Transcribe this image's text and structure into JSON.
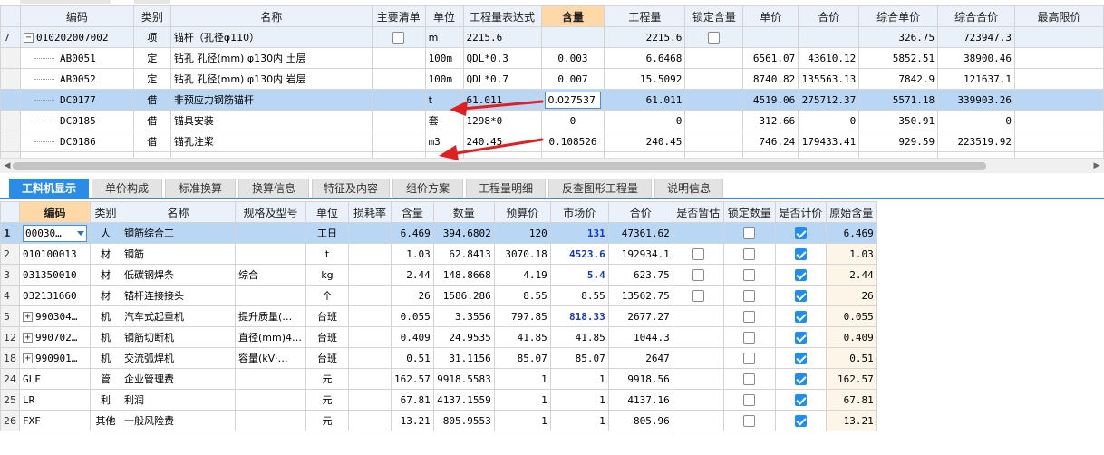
{
  "top_grid": {
    "columns": [
      "编码",
      "类别",
      "名称",
      "主要清单",
      "单位",
      "工程量表达式",
      "含量",
      "工程量",
      "锁定含量",
      "单价",
      "合价",
      "综合单价",
      "综合合价",
      "最高限价"
    ],
    "rows": [
      {
        "rn": "7",
        "code": "010202007002",
        "type": "项",
        "name": "锚杆（孔径φ110）",
        "main": "unchecked",
        "unit": "m",
        "expr": "2215.6",
        "qty_ratio": "",
        "qty": "2215.6",
        "lock": "unchecked",
        "price": "",
        "total": "",
        "comp_price": "326.75",
        "comp_total": "723947.3"
      },
      {
        "rn": "",
        "code": "AB0051",
        "type": "定",
        "name": "钻孔 孔径(mm) φ130内 土层",
        "unit": "100m",
        "expr": "QDL*0.3",
        "qty_ratio": "0.003",
        "qty": "6.6468",
        "price": "6561.07",
        "total": "43610.12",
        "comp_price": "5852.51",
        "comp_total": "38900.46"
      },
      {
        "rn": "",
        "code": "AB0052",
        "type": "定",
        "name": "钻孔 孔径(mm) φ130内 岩层",
        "unit": "100m",
        "expr": "QDL*0.7",
        "qty_ratio": "0.007",
        "qty": "15.5092",
        "price": "8740.82",
        "total": "135563.13",
        "comp_price": "7842.9",
        "comp_total": "121637.1"
      },
      {
        "rn": "",
        "code": "DC0177",
        "type": "借",
        "name": "非预应力钢筋锚杆",
        "unit": "t",
        "expr": "61.011",
        "qty_ratio": "0.027537",
        "qty": "61.011",
        "price": "4519.06",
        "total": "275712.37",
        "comp_price": "5571.18",
        "comp_total": "339903.26"
      },
      {
        "rn": "",
        "code": "DC0185",
        "type": "借",
        "name": "锚具安装",
        "unit": "套",
        "expr": "1298*0",
        "qty_ratio": "0",
        "qty": "0",
        "price": "312.66",
        "total": "0",
        "comp_price": "350.91",
        "comp_total": "0"
      },
      {
        "rn": "",
        "code": "DC0186",
        "type": "借",
        "name": "锚孔注浆",
        "unit": "m3",
        "expr": "240.45",
        "qty_ratio": "0.108526",
        "qty": "240.45",
        "price": "746.24",
        "total": "179433.41",
        "comp_price": "929.59",
        "comp_total": "223519.92"
      }
    ]
  },
  "scroll": {
    "left_arrow": "◀",
    "right_arrow": "▶"
  },
  "tabs": [
    "工料机显示",
    "单价构成",
    "标准换算",
    "换算信息",
    "特征及内容",
    "组价方案",
    "工程量明细",
    "反查图形工程量",
    "说明信息"
  ],
  "bottom_grid": {
    "columns": [
      "",
      "编码",
      "类别",
      "名称",
      "规格及型号",
      "单位",
      "损耗率",
      "含量",
      "数量",
      "预算价",
      "市场价",
      "合价",
      "是否暂估",
      "锁定数量",
      "是否计价",
      "原始含量"
    ],
    "rows": [
      {
        "rn": "1",
        "code": "00030…",
        "type": "人",
        "name": "钢筋综合工",
        "spec": "",
        "unit": "工日",
        "loss": "",
        "ratio": "6.469",
        "qty": "394.6802",
        "budget": "120",
        "market": "131",
        "total": "47361.62",
        "est": "none",
        "lock": "unchecked",
        "priced": "checked",
        "orig": "6.469"
      },
      {
        "rn": "2",
        "code": "010100013",
        "type": "材",
        "name": "钢筋",
        "spec": "",
        "unit": "t",
        "loss": "",
        "ratio": "1.03",
        "qty": "62.8413",
        "budget": "3070.18",
        "market": "4523.6",
        "total": "192934.1",
        "est": "unchecked",
        "lock": "unchecked",
        "priced": "checked",
        "orig": "1.03"
      },
      {
        "rn": "3",
        "code": "031350010",
        "type": "材",
        "name": "低碳钢焊条",
        "spec": "综合",
        "unit": "kg",
        "loss": "",
        "ratio": "2.44",
        "qty": "148.8668",
        "budget": "4.19",
        "market": "5.4",
        "total": "623.75",
        "est": "unchecked",
        "lock": "unchecked",
        "priced": "checked",
        "orig": "2.44"
      },
      {
        "rn": "4",
        "code": "032131660",
        "type": "材",
        "name": "锚杆连接接头",
        "spec": "",
        "unit": "个",
        "loss": "",
        "ratio": "26",
        "qty": "1586.286",
        "budget": "8.55",
        "market": "8.55",
        "total": "13562.75",
        "est": "unchecked",
        "lock": "unchecked",
        "priced": "checked",
        "orig": "26"
      },
      {
        "rn": "5",
        "code": "990304…",
        "type": "机",
        "name": "汽车式起重机",
        "spec": "提升质量(…",
        "unit": "台班",
        "loss": "",
        "ratio": "0.055",
        "qty": "3.3556",
        "budget": "797.85",
        "market": "818.33",
        "total": "2677.27",
        "est": "none",
        "lock": "unchecked",
        "priced": "checked",
        "orig": "0.055"
      },
      {
        "rn": "12",
        "code": "990702…",
        "type": "机",
        "name": "钢筋切断机",
        "spec": "直径(mm)4…",
        "unit": "台班",
        "loss": "",
        "ratio": "0.409",
        "qty": "24.9535",
        "budget": "41.85",
        "market": "41.85",
        "total": "1044.3",
        "est": "none",
        "lock": "unchecked",
        "priced": "checked",
        "orig": "0.409"
      },
      {
        "rn": "18",
        "code": "990901…",
        "type": "机",
        "name": "交流弧焊机",
        "spec": "容量(kV·…",
        "unit": "台班",
        "loss": "",
        "ratio": "0.51",
        "qty": "31.1156",
        "budget": "85.07",
        "market": "85.07",
        "total": "2647",
        "est": "none",
        "lock": "unchecked",
        "priced": "checked",
        "orig": "0.51"
      },
      {
        "rn": "24",
        "code": "GLF",
        "type": "管",
        "name": "企业管理费",
        "spec": "",
        "unit": "元",
        "loss": "",
        "ratio": "162.57",
        "qty": "9918.5583",
        "budget": "1",
        "market": "1",
        "total": "9918.56",
        "est": "none",
        "lock": "unchecked",
        "priced": "checked",
        "orig": "162.57"
      },
      {
        "rn": "25",
        "code": "LR",
        "type": "利",
        "name": "利润",
        "spec": "",
        "unit": "元",
        "loss": "",
        "ratio": "67.81",
        "qty": "4137.1559",
        "budget": "1",
        "market": "1",
        "total": "4137.16",
        "est": "none",
        "lock": "unchecked",
        "priced": "checked",
        "orig": "67.81"
      },
      {
        "rn": "26",
        "code": "FXF",
        "type": "其他",
        "name": "一般风险费",
        "spec": "",
        "unit": "元",
        "loss": "",
        "ratio": "13.21",
        "qty": "805.9553",
        "budget": "1",
        "market": "1",
        "total": "805.96",
        "est": "none",
        "lock": "unchecked",
        "priced": "checked",
        "orig": "13.21"
      }
    ]
  },
  "colors": {
    "accent": "#2a8ce8",
    "selected_row": "#b9d7f5",
    "highlight_header": "#ffd8a8",
    "arrow": "#e02020",
    "market_blue": "#1339c8"
  }
}
